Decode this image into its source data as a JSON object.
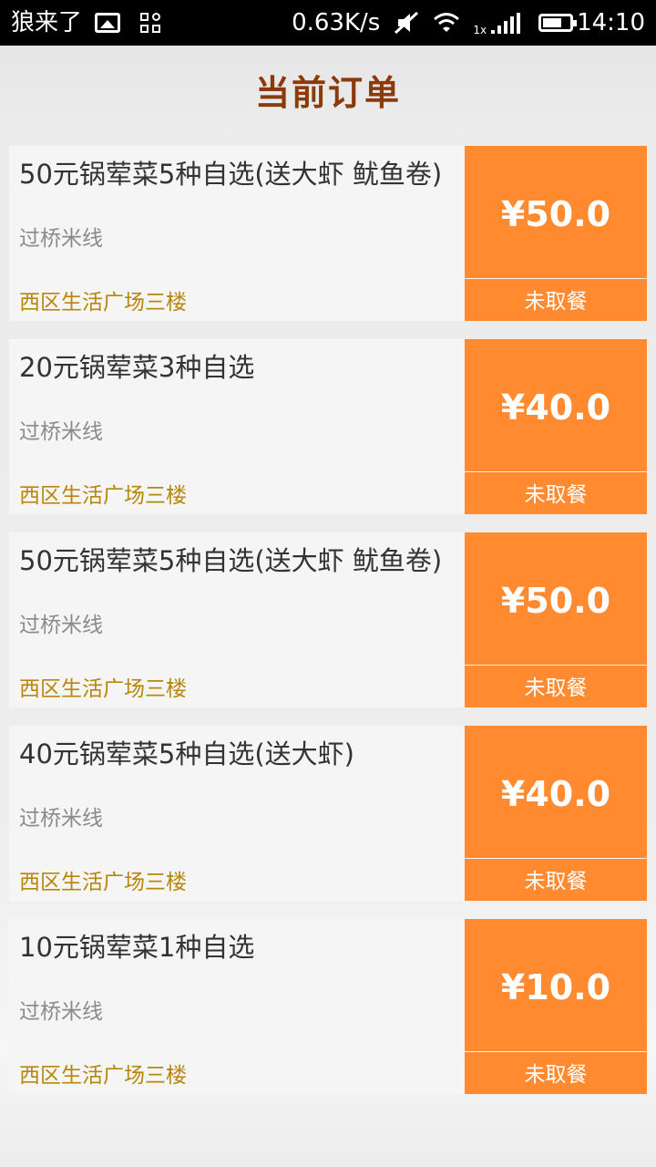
{
  "status_bar": {
    "carrier": "狼来了",
    "network_speed": "0.63K/s",
    "signal_label": "1x",
    "time": "14:10",
    "icons": [
      "gallery-icon",
      "apps-icon",
      "mute-icon",
      "wifi-icon",
      "signal-icon",
      "battery-icon"
    ]
  },
  "header": {
    "title": "当前订单"
  },
  "colors": {
    "title": "#8b3a0c",
    "price_bg": "#ff8a30",
    "location_text": "#b8860b",
    "card_bg": "#f5f5f5"
  },
  "orders": [
    {
      "name": "50元锅荤菜5种自选(送大虾 鱿鱼卷)",
      "shop": "过桥米线",
      "location": "西区生活广场三楼",
      "price": "¥50.0",
      "status": "未取餐"
    },
    {
      "name": "20元锅荤菜3种自选",
      "shop": "过桥米线",
      "location": "西区生活广场三楼",
      "price": "¥40.0",
      "status": "未取餐"
    },
    {
      "name": "50元锅荤菜5种自选(送大虾 鱿鱼卷)",
      "shop": "过桥米线",
      "location": "西区生活广场三楼",
      "price": "¥50.0",
      "status": "未取餐"
    },
    {
      "name": "40元锅荤菜5种自选(送大虾)",
      "shop": "过桥米线",
      "location": "西区生活广场三楼",
      "price": "¥40.0",
      "status": "未取餐"
    },
    {
      "name": "10元锅荤菜1种自选",
      "shop": "过桥米线",
      "location": "西区生活广场三楼",
      "price": "¥10.0",
      "status": "未取餐"
    }
  ]
}
